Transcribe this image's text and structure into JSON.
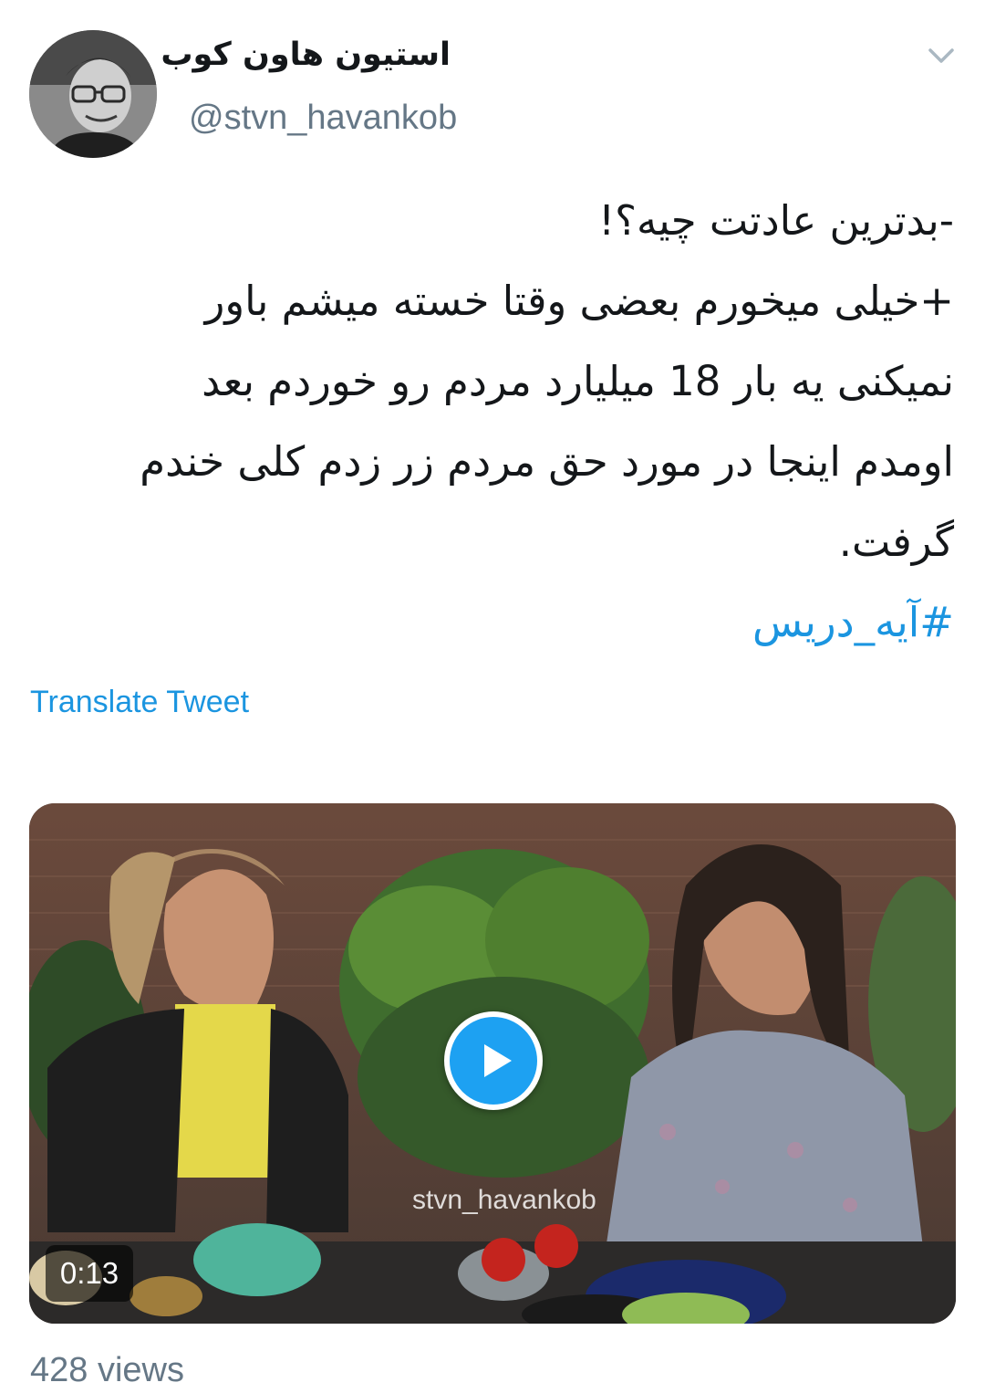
{
  "tweet": {
    "author": {
      "display_name": "استیون هاون کوب",
      "handle": "@stvn_havankob"
    },
    "text_lines": [
      "-بدترین عادتت چیه؟!",
      "+خیلی میخورم بعضی وقتا خسته میشم باور",
      "نمیکنی یه بار 18 میلیارد مردم رو خوردم بعد",
      "اومدم اینجا در مورد حق مردم زر زدم کلی خندم",
      "گرفت."
    ],
    "hashtag": "#آیه_دریس",
    "translate_label": "Translate Tweet",
    "media": {
      "duration": "0:13",
      "watermark": "stvn_havankob"
    },
    "views": "428 views"
  },
  "colors": {
    "link": "#1b95e0",
    "secondary_text": "#657786",
    "primary_text": "#14171a",
    "play_button": "#1da1f2"
  },
  "icons": {
    "menu": "chevron-down-icon",
    "play": "play-icon"
  }
}
